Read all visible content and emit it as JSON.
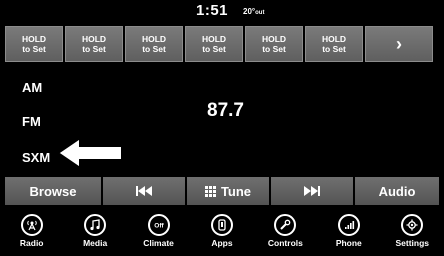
{
  "status": {
    "time": "1:51",
    "temp_value": "20°",
    "temp_unit": "out"
  },
  "presets": [
    {
      "line1": "HOLD",
      "line2": "to Set"
    },
    {
      "line1": "HOLD",
      "line2": "to Set"
    },
    {
      "line1": "HOLD",
      "line2": "to Set"
    },
    {
      "line1": "HOLD",
      "line2": "to Set"
    },
    {
      "line1": "HOLD",
      "line2": "to Set"
    },
    {
      "line1": "HOLD",
      "line2": "to Set"
    }
  ],
  "bands": {
    "am": "AM",
    "fm": "FM",
    "sxm": "SXM"
  },
  "frequency": "87.7",
  "toolbar": {
    "browse": "Browse",
    "tune": "Tune",
    "audio": "Audio"
  },
  "dock": [
    {
      "label": "Radio",
      "icon": "radio-antenna-icon"
    },
    {
      "label": "Media",
      "icon": "music-note-icon"
    },
    {
      "label": "Climate",
      "icon": "climate-off-icon"
    },
    {
      "label": "Apps",
      "icon": "apps-icon"
    },
    {
      "label": "Controls",
      "icon": "wrench-icon"
    },
    {
      "label": "Phone",
      "icon": "phone-icon"
    },
    {
      "label": "Settings",
      "icon": "gear-icon"
    }
  ]
}
